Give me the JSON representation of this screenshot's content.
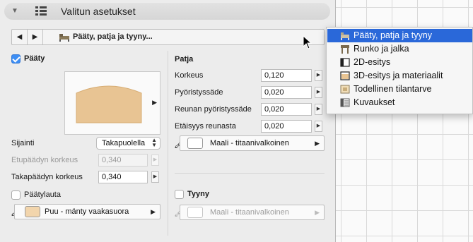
{
  "header": {
    "title": "Valitun asetukset"
  },
  "nav": {
    "prev_symbol": "◀",
    "next_symbol": "▶",
    "current": "Pääty, patja ja tyyny..."
  },
  "paaty": {
    "checkbox_label": "Pääty",
    "checked": true,
    "sijainti_label": "Sijainti",
    "sijainti_value": "Takapuolella",
    "etu_label": "Etupäädyn korkeus",
    "etu_value": "0,340",
    "taka_label": "Takapäädyn korkeus",
    "taka_value": "0,340",
    "paatylauta_label": "Päätylauta",
    "paatylauta_checked": false,
    "material": "Puu - mänty vaakasuora",
    "material_color": "#f2d5ac"
  },
  "patja": {
    "title": "Patja",
    "korkeus_label": "Korkeus",
    "korkeus_value": "0,120",
    "pyor_label": "Pyöristyssäde",
    "pyor_value": "0,020",
    "reunan_label": "Reunan pyöristyssäde",
    "reunan_value": "0,020",
    "etaisyys_label": "Etäisyys reunasta",
    "etaisyys_value": "0,020",
    "material": "Maali - titaanivalkoinen",
    "material_color": "#ffffff"
  },
  "tyyny": {
    "checkbox_label": "Tyyny",
    "checked": false,
    "material": "Maali - titaanivalkoinen"
  },
  "menu": {
    "items": [
      {
        "label": "Pääty, patja ja tyyny",
        "icon": "bed-icon",
        "selected": true
      },
      {
        "label": "Runko ja jalka",
        "icon": "frame-icon",
        "selected": false
      },
      {
        "label": "2D-esitys",
        "icon": "plan-icon",
        "selected": false
      },
      {
        "label": "3D-esitys ja materiaalit",
        "icon": "3d-icon",
        "selected": false
      },
      {
        "label": "Todellinen tilantarve",
        "icon": "space-icon",
        "selected": false
      },
      {
        "label": "Kuvaukset",
        "icon": "description-icon",
        "selected": false
      }
    ]
  },
  "colors": {
    "accent": "#2a68d9",
    "checkbox": "#3d8ef4",
    "wood_preview": "#e9c595"
  }
}
